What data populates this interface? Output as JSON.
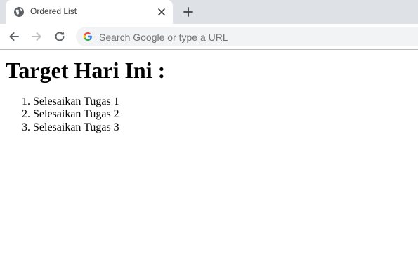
{
  "browser": {
    "tab_title": "Ordered List",
    "omnibox_placeholder": "Search Google or type a URL"
  },
  "page": {
    "heading": "Target Hari Ini :",
    "list_items": [
      "Selesaikan Tugas 1",
      "Selesaikan Tugas 2",
      "Selesaikan Tugas 3"
    ]
  },
  "icons": {
    "tab": "globe-icon",
    "close": "close-icon",
    "new_tab": "plus-icon",
    "back": "arrow-left-icon",
    "forward": "arrow-right-icon",
    "reload": "reload-icon",
    "search": "google-g-icon"
  },
  "colors": {
    "tabstrip": "#dee1e6",
    "omnibox": "#f1f3f4",
    "icon": "#5f6368",
    "icon_disabled": "#babcbe"
  }
}
